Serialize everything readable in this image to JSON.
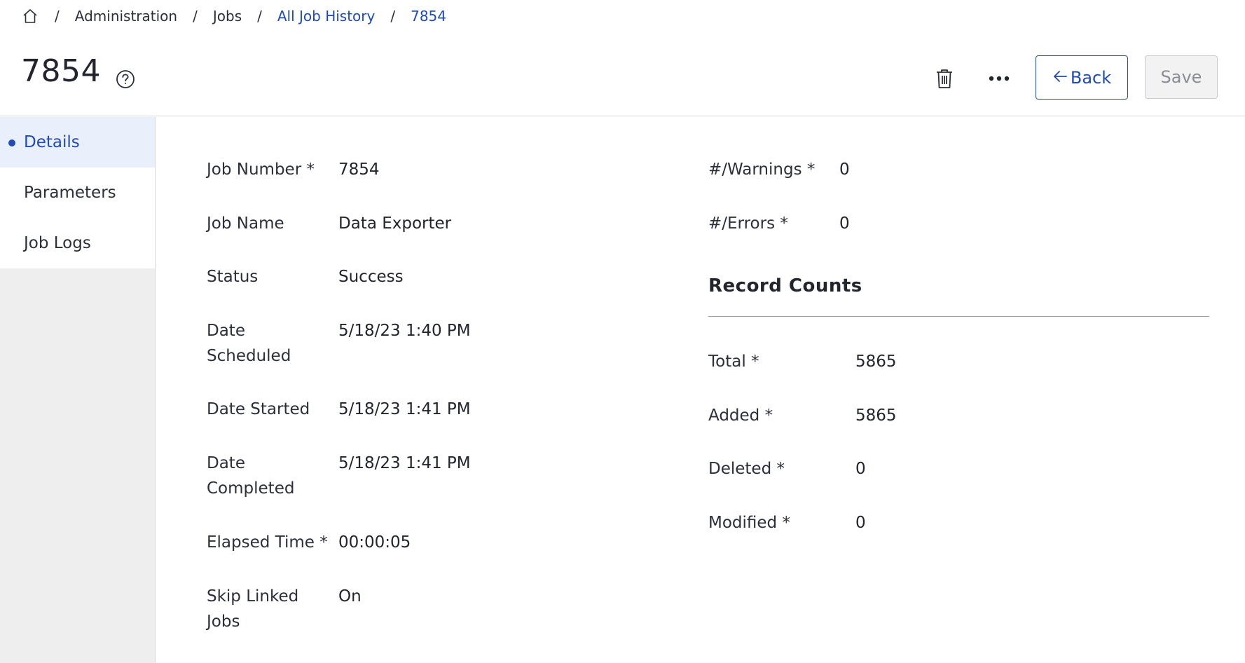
{
  "breadcrumb": {
    "home_icon": "home-icon",
    "items": [
      "Administration",
      "Jobs",
      "All Job History",
      "7854"
    ],
    "separator": "/"
  },
  "header": {
    "title": "7854",
    "help_icon": "question-circle-icon",
    "delete_icon": "trash-icon",
    "more_icon": "ellipsis-icon",
    "back_label": "Back",
    "save_label": "Save"
  },
  "sidebar": {
    "items": [
      {
        "label": "Details",
        "active": true
      },
      {
        "label": "Parameters",
        "active": false
      },
      {
        "label": "Job Logs",
        "active": false
      }
    ]
  },
  "details": {
    "job_number_label": "Job Number",
    "job_number": "7854",
    "job_name_label": "Job Name",
    "job_name": "Data Exporter",
    "status_label": "Status",
    "status": "Success",
    "date_scheduled_label_1": "Date",
    "date_scheduled_label_2": "Scheduled",
    "date_scheduled": "5/18/23 1:40 PM",
    "date_started_label": "Date Started",
    "date_started": "5/18/23 1:41 PM",
    "date_completed_label_1": "Date",
    "date_completed_label_2": "Completed",
    "date_completed": "5/18/23 1:41 PM",
    "elapsed_time_label": "Elapsed Time",
    "elapsed_time": "00:00:05",
    "skip_linked_label_1": "Skip Linked",
    "skip_linked_label_2": "Jobs",
    "skip_linked": "On",
    "warnings_label": "#/Warnings",
    "warnings": "0",
    "errors_label": "#/Errors",
    "errors": "0",
    "required_marker": "*"
  },
  "record_counts": {
    "title": "Record Counts",
    "total_label": "Total",
    "total": "5865",
    "added_label": "Added",
    "added": "5865",
    "deleted_label": "Deleted",
    "deleted": "0",
    "modified_label": "Modified",
    "modified": "0"
  },
  "colors": {
    "accent": "#1f4ab8",
    "sidebar_bg": "#eeeeef",
    "active_bg": "#eaf0fb"
  }
}
